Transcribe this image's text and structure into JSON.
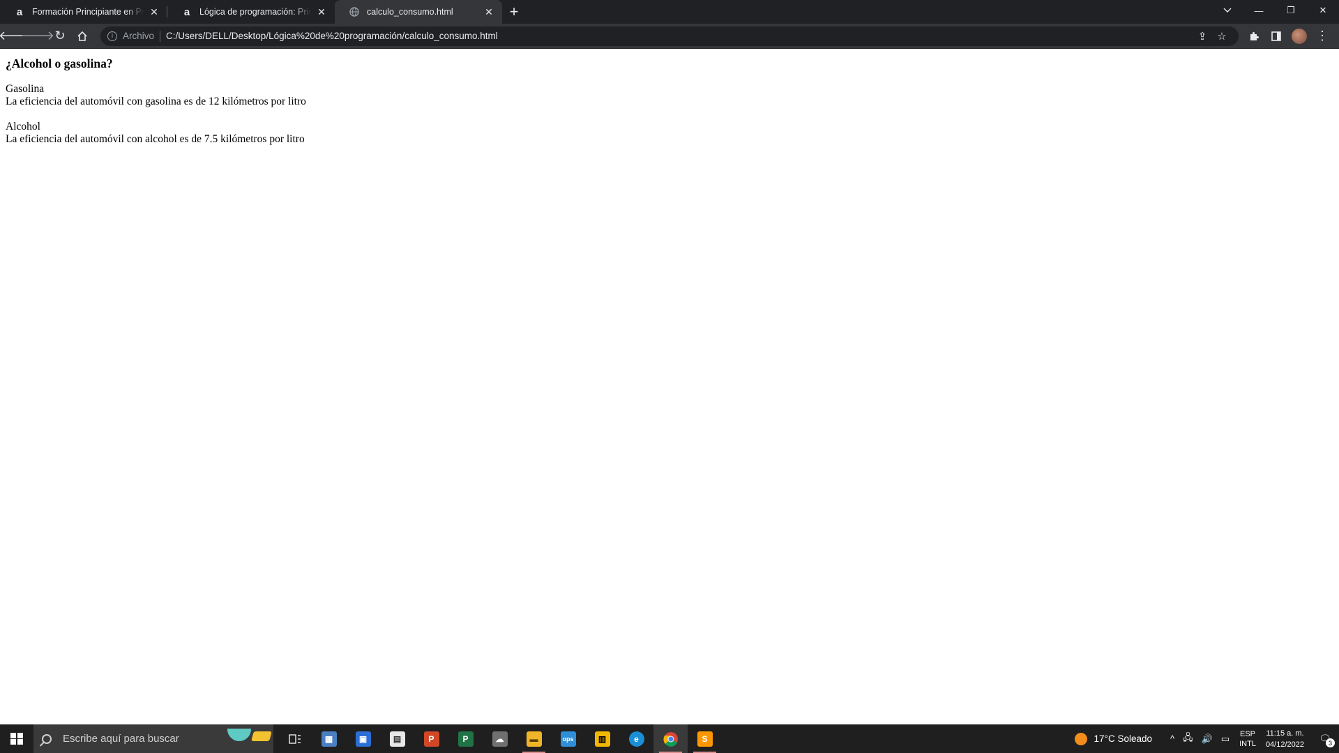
{
  "browser": {
    "tabs": [
      {
        "title": "Formación Principiante en Progra",
        "favicon": "a",
        "active": false
      },
      {
        "title": "Lógica de programación: Primero",
        "favicon": "a",
        "active": false
      },
      {
        "title": "calculo_consumo.html",
        "favicon": "globe-icon",
        "active": true
      }
    ],
    "new_tab_label": "+",
    "address": {
      "scheme_label": "Archivo",
      "url": "C:/Users/DELL/Desktop/Lógica%20de%20programación/calculo_consumo.html"
    }
  },
  "page": {
    "heading": "¿Alcohol o gasolina?",
    "sections": [
      {
        "label": "Gasolina",
        "text": "La eficiencia del automóvil con gasolina es de 12 kilómetros por litro"
      },
      {
        "label": "Alcohol",
        "text": "La eficiencia del automóvil con alcohol es de 7.5 kilómetros por litro"
      }
    ]
  },
  "taskbar": {
    "search_placeholder": "Escribe aquí para buscar",
    "weather": "17°C  Soleado",
    "language_top": "ESP",
    "language_bottom": "INTL",
    "time": "11:15 a. m.",
    "date": "04/12/2022",
    "notification_count": "3",
    "colors": {
      "accent": "#f28c1b",
      "open_indicator": "#d98f8f"
    }
  }
}
